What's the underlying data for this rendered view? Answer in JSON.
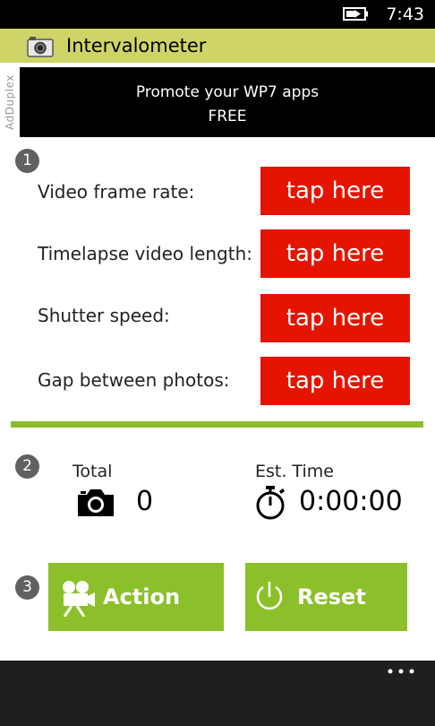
{
  "status_bar": {
    "time": "7:43",
    "battery_icon": "battery-charging-icon"
  },
  "header": {
    "title": "Intervalometer",
    "icon": "camera-icon"
  },
  "ad": {
    "side_label": "AdDuplex",
    "line1": "Promote your WP7 apps",
    "line2": "FREE"
  },
  "steps": [
    "1",
    "2",
    "3"
  ],
  "settings": [
    {
      "label": "Video frame rate:",
      "button": "tap here"
    },
    {
      "label": "Timelapse video length:",
      "button": "tap here"
    },
    {
      "label": "Shutter speed:",
      "button": "tap here"
    },
    {
      "label": "Gap between photos:",
      "button": "tap here"
    }
  ],
  "stats": {
    "total_label": "Total",
    "total_value": "0",
    "total_icon": "camera-icon",
    "time_label": "Est. Time",
    "time_value": "0:00:00",
    "time_icon": "stopwatch-icon"
  },
  "actions": {
    "action_label": "Action",
    "action_icon": "video-camera-icon",
    "reset_label": "Reset",
    "reset_icon": "power-icon"
  },
  "app_bar": {
    "more_icon": "ellipsis-icon"
  },
  "colors": {
    "accent_green": "#8cc02a",
    "button_red": "#e51400",
    "title_bar": "#cfd469"
  }
}
